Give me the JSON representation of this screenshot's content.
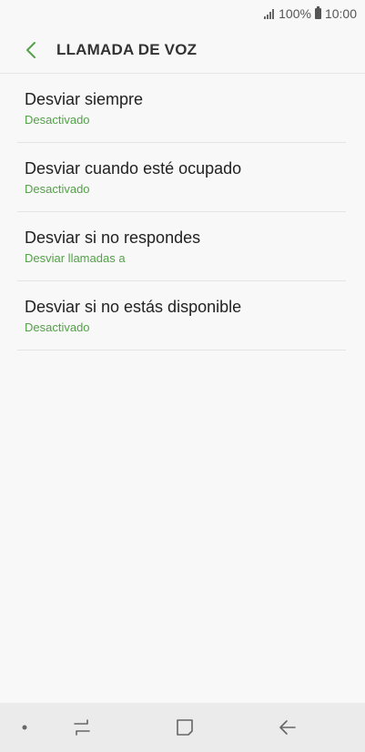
{
  "status_bar": {
    "battery_text": "100%",
    "time": "10:00"
  },
  "header": {
    "title": "LLAMADA DE VOZ",
    "back_icon": "chevron-left-icon"
  },
  "items": [
    {
      "title": "Desviar siempre",
      "status": "Desactivado"
    },
    {
      "title": "Desviar cuando esté ocupado",
      "status": "Desactivado"
    },
    {
      "title": "Desviar si no respondes",
      "status": "Desviar llamadas a"
    },
    {
      "title": "Desviar si no estás disponible",
      "status": "Desactivado"
    }
  ],
  "nav_bar": {
    "icons": [
      "dot-icon",
      "recent-apps-icon",
      "home-icon",
      "back-arrow-icon"
    ]
  },
  "colors": {
    "accent_green": "#55a04a",
    "background": "#f8f8f8",
    "nav_background": "#ebebeb"
  }
}
